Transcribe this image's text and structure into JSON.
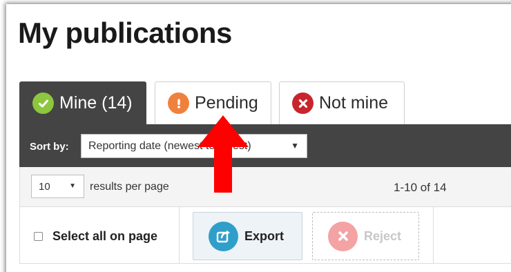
{
  "page": {
    "title": "My publications"
  },
  "tabs": [
    {
      "label": "Mine (14)",
      "icon": "check-circle-icon",
      "color": "#8dc63f",
      "active": true
    },
    {
      "label": "Pending",
      "icon": "exclamation-circle-icon",
      "color": "#f0813c",
      "active": false
    },
    {
      "label": "Not mine",
      "icon": "x-circle-icon",
      "color": "#c9252c",
      "active": false
    }
  ],
  "sort": {
    "label": "Sort by:",
    "value": "Reporting date (newest to oldest)"
  },
  "pagination": {
    "per_page": "10",
    "per_page_label": "results per page",
    "range": "1-10 of 14"
  },
  "actions": {
    "select_all_label": "Select all on page",
    "export_label": "Export",
    "reject_label": "Reject",
    "export_color": "#2f9fc9",
    "reject_color": "#f4a3a5"
  },
  "annotation": {
    "arrow_color": "#ff0000"
  }
}
